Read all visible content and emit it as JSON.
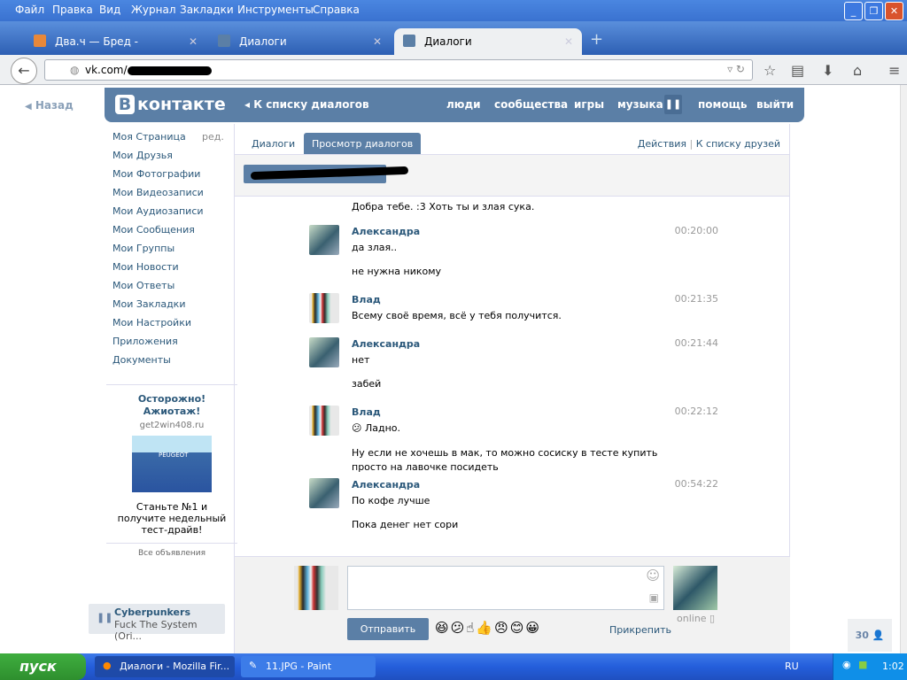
{
  "browser": {
    "menu": [
      "Файл",
      "Правка",
      "Вид",
      "Журнал",
      "Закладки",
      "Инструменты",
      "Справка"
    ],
    "tabs": [
      {
        "label": "Два.ч — Бред -"
      },
      {
        "label": "Диалоги"
      },
      {
        "label": "Диалоги"
      }
    ],
    "url": "vk.com/"
  },
  "vk": {
    "logo": "контакте",
    "back_link": "Назад",
    "header_back": "К списку диалогов",
    "nav": [
      "люди",
      "сообщества",
      "игры",
      "музыка",
      "помощь",
      "выйти"
    ],
    "sidebar": [
      "Моя Страница",
      "Мои Друзья",
      "Мои Фотографии",
      "Мои Видеозаписи",
      "Мои Аудиозаписи",
      "Мои Сообщения",
      "Мои Группы",
      "Мои Новости",
      "Мои Ответы",
      "Мои Закладки",
      "Мои Настройки"
    ],
    "sidebar_edit": "ред.",
    "sidebar_extra": [
      "Приложения",
      "Документы"
    ],
    "ad": {
      "title": "Осторожно! Ажиотаж!",
      "domain": "get2win408.ru",
      "image_text": "PEUGEOT",
      "text": "Станьте №1 и получите недельный тест-драйв!",
      "all": "Все объявления"
    },
    "player": {
      "artist": "Cyberpunkers",
      "track": "Fuck The System (Ori..."
    },
    "tabs": {
      "dialogs": "Диалоги",
      "view": "Просмотр диалогов",
      "actions": "Действия",
      "to_friends": "К списку друзей"
    },
    "messages": [
      {
        "author": "",
        "time": "",
        "lines": [
          "Добра тебе. :3 Хоть ты и злая сука."
        ]
      },
      {
        "author": "Александра",
        "time": "00:20:00",
        "avatar": "a",
        "lines": [
          "да злая..",
          "не нужна никому"
        ]
      },
      {
        "author": "Влад",
        "time": "00:21:35",
        "avatar": "v",
        "lines": [
          "Всему своё время, всё у тебя получится."
        ]
      },
      {
        "author": "Александра",
        "time": "00:21:44",
        "avatar": "a",
        "lines": [
          "нет",
          "забей"
        ]
      },
      {
        "author": "Влад",
        "time": "00:22:12",
        "avatar": "v",
        "lines": [
          "😕 Ладно.",
          "Ну если не хочешь в мак, то можно сосиску в тесте купить просто на лавочке посидеть"
        ]
      },
      {
        "author": "Александра",
        "time": "00:54:22",
        "avatar": "a",
        "lines": [
          "По кофе лучше",
          "Пока денег нет сори"
        ]
      }
    ],
    "compose": {
      "send": "Отправить",
      "attach": "Прикрепить",
      "status": "online",
      "emojis": [
        "😆",
        "😕",
        "☝",
        "👍",
        "😠",
        "😊",
        "😀"
      ]
    },
    "friends_count": "30"
  },
  "taskbar": {
    "start": "пуск",
    "items": [
      "Диалоги - Mozilla Fir...",
      "11.JPG - Paint"
    ],
    "lang": "RU",
    "clock": "1:02"
  }
}
